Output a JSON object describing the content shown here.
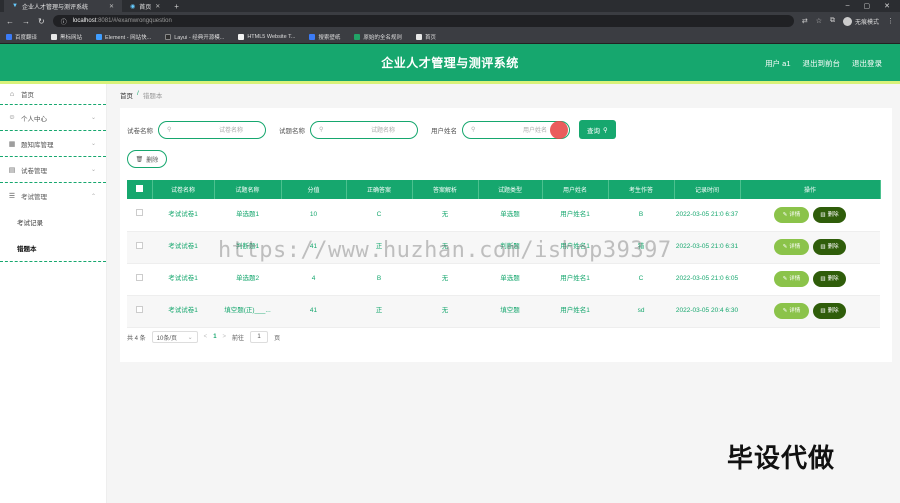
{
  "browser": {
    "tabs": [
      {
        "label": "企业人才管理与测评系统",
        "active": true
      },
      {
        "label": "首页",
        "active": false
      }
    ],
    "new_tab": "+",
    "url_host": "localhost",
    "url_rest": ":8081/#/examwrongquestion",
    "profile": "无痕模式",
    "bookmarks": [
      {
        "label": "百度翻译",
        "color": "#3b7bf6"
      },
      {
        "label": "黑标网站",
        "color": "#e7e7e7"
      },
      {
        "label": "Element - 网站快...",
        "color": "#409eff"
      },
      {
        "label": "Layui - 经典开源模...",
        "color": "#2f2f2f"
      },
      {
        "label": "HTML5 Website T...",
        "color": "#f2f2f2"
      },
      {
        "label": "搜索壁纸",
        "color": "#3b7bf6"
      },
      {
        "label": "原始的全名规则",
        "color": "#21a366"
      },
      {
        "label": "首页",
        "color": "#e7e7e7"
      }
    ]
  },
  "header": {
    "title": "企业人才管理与测评系统",
    "user": "用户 a1",
    "back_label": "退出到前台",
    "logout_label": "退出登录"
  },
  "sidebar": {
    "home": "首页",
    "items": [
      {
        "label": "个人中心",
        "icon": "user-icon"
      },
      {
        "label": "题知库管理",
        "icon": "book-icon"
      },
      {
        "label": "试卷管理",
        "icon": "paper-icon"
      },
      {
        "label": "考试管理",
        "icon": "list-icon"
      }
    ],
    "sub_items": [
      {
        "label": "考试记录",
        "active": false
      },
      {
        "label": "错题本",
        "active": true
      }
    ]
  },
  "breadcrumb": {
    "home": "首页",
    "sep": "/",
    "current": "错题本"
  },
  "search": {
    "field1_label": "试卷名称",
    "field1_placeholder": "试卷名称",
    "field2_label": "试题名称",
    "field2_placeholder": "试题名称",
    "field3_label": "用户姓名",
    "field3_placeholder": "用户姓名",
    "button": "查询",
    "delete_button": "删除"
  },
  "table": {
    "headers": [
      "试卷名称",
      "试题名称",
      "分值",
      "正确答案",
      "答案解析",
      "试题类型",
      "用户姓名",
      "考生作答",
      "记录时间",
      "操作"
    ],
    "rows": [
      {
        "paper": "考试试卷1",
        "question": "单选题1",
        "score": "10",
        "answer": "C",
        "analysis": "无",
        "type": "单选题",
        "user": "用户姓名1",
        "response": "B",
        "time": "2022-03-05 21:0 6:37"
      },
      {
        "paper": "考试试卷1",
        "question": "判断题1",
        "score": "41",
        "answer": "正",
        "analysis": "无",
        "type": "判断题",
        "user": "用户姓名1",
        "response": "错",
        "time": "2022-03-05 21:0 6:31"
      },
      {
        "paper": "考试试卷1",
        "question": "单选题2",
        "score": "4",
        "answer": "B",
        "analysis": "无",
        "type": "单选题",
        "user": "用户姓名1",
        "response": "C",
        "time": "2022-03-05 21:0 6:05"
      },
      {
        "paper": "考试试卷1",
        "question": "填空题(正)___...",
        "score": "41",
        "answer": "正",
        "analysis": "无",
        "type": "填空题",
        "user": "用户姓名1",
        "response": "sd",
        "time": "2022-03-05 20:4 6:30"
      }
    ],
    "detail_label": "详情",
    "delete_label": "删除"
  },
  "pager": {
    "total": "共 4 条",
    "size": "10条/页",
    "prev": "<",
    "page": "1",
    "next": ">",
    "goto_label": "前往",
    "goto_value": "1",
    "page_unit": "页"
  },
  "overlay": {
    "watermark": "https://www.huzhan.com/ishop39397",
    "bigmark": "毕设代做"
  },
  "colors": {
    "primary": "#16a76e",
    "accent_strip": "#d9f27a",
    "detail": "#8bc34a",
    "delete": "#2f5d0a"
  }
}
